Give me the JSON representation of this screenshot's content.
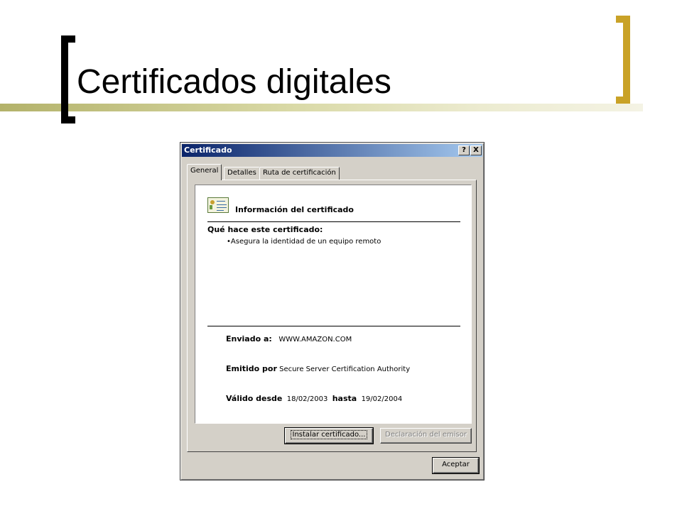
{
  "slide": {
    "title": "Certificados digitales",
    "colors": {
      "accent_gold": "#c9a227",
      "bar_olive": "#b3b26a"
    }
  },
  "dialog": {
    "title": "Certificado",
    "help_button": "?",
    "close_button": "X",
    "tabs": [
      {
        "label": "General",
        "active": true
      },
      {
        "label": "Detalles",
        "active": false
      },
      {
        "label": "Ruta de certificación",
        "active": false
      }
    ],
    "info_heading": "Información del certificado",
    "purpose_heading": "Qué hace este certificado:",
    "purposes": [
      "•Asegura la identidad de un equipo remoto"
    ],
    "issued_to_label": "Enviado a:",
    "issued_to_value": "WWW.AMAZON.COM",
    "issued_by_label": "Emitido por",
    "issued_by_value": "Secure Server Certification Authority",
    "valid_from_label": "Válido desde",
    "valid_from_value": "18/02/2003",
    "valid_to_label": "hasta",
    "valid_to_value": "19/02/2004",
    "install_button": "Instalar certificado...",
    "issuer_statement_button": "Declaración del emisor",
    "ok_button": "Aceptar",
    "icon": "certificate-icon"
  }
}
